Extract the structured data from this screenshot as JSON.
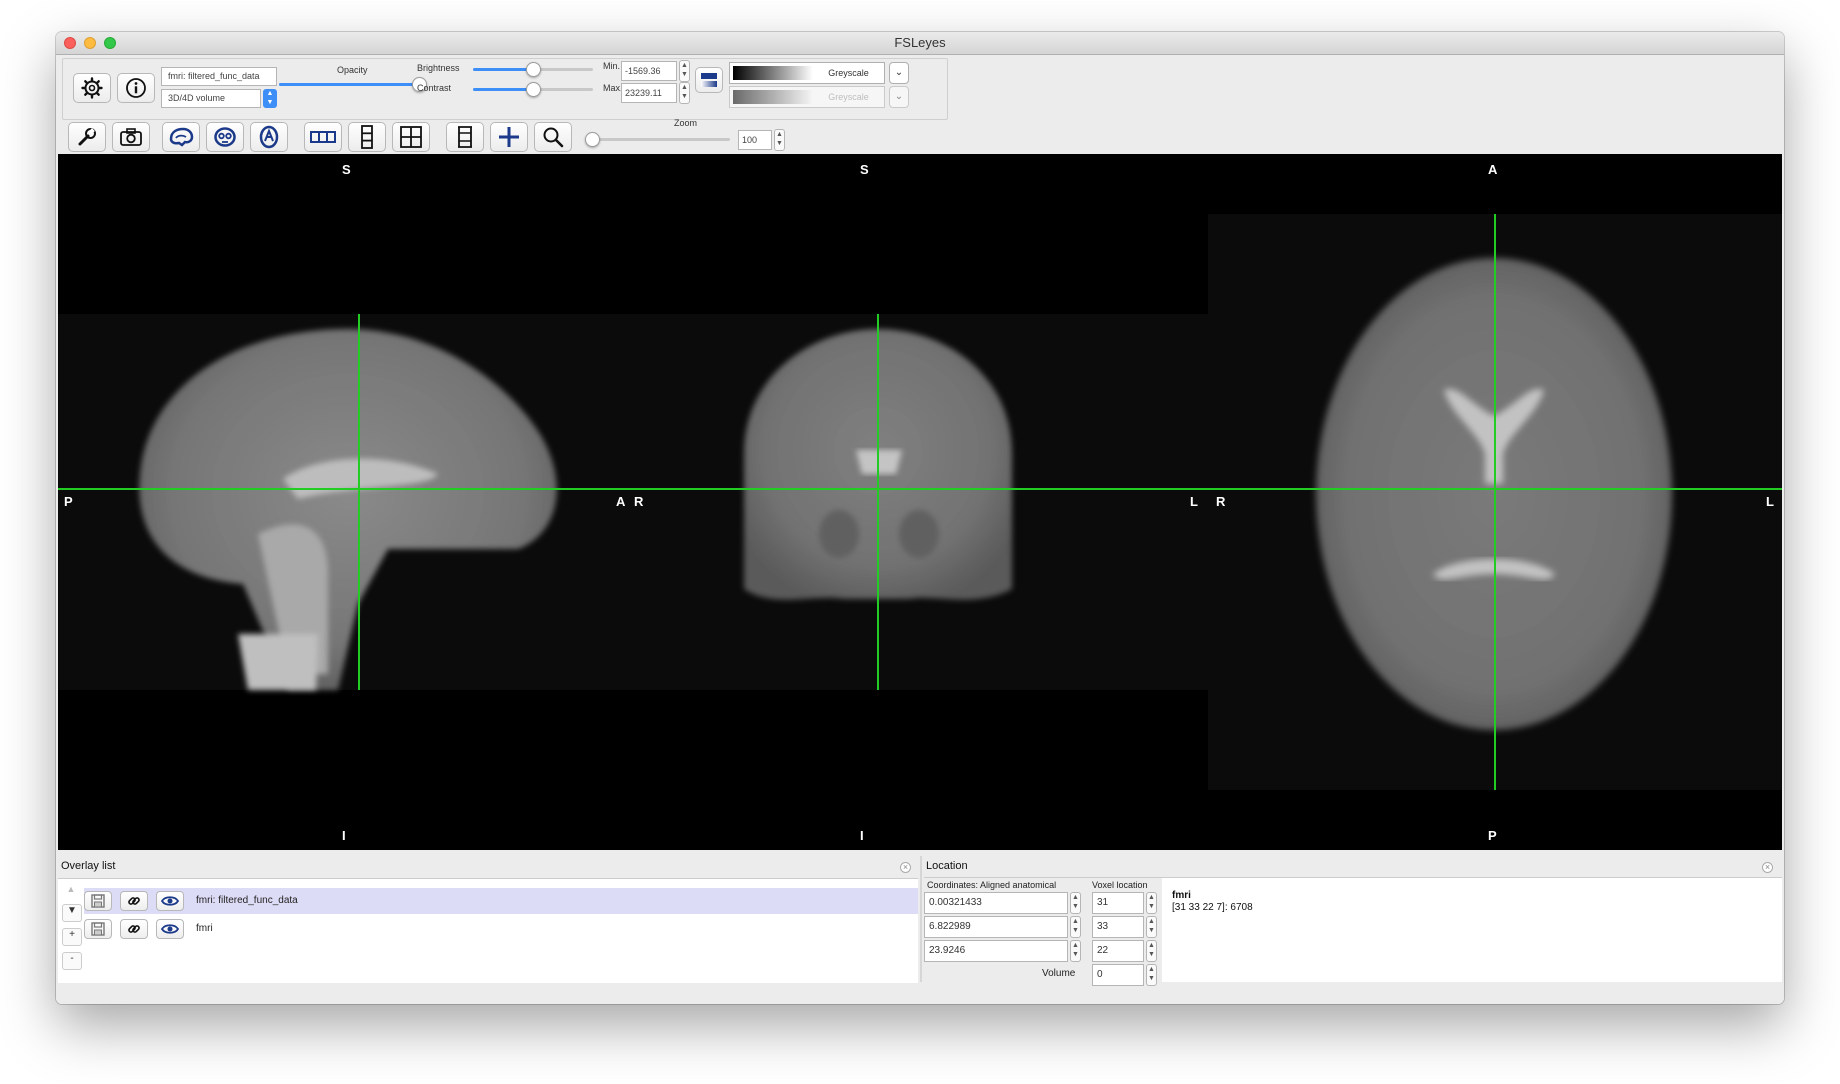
{
  "window": {
    "title": "FSLeyes"
  },
  "overlay_toolbar": {
    "overlay_name": "fmri: filtered_func_data",
    "overlay_type": "3D/4D volume",
    "opacity_label": "Opacity",
    "opacity": 1.0,
    "brightness_label": "Brightness",
    "brightness": 0.5,
    "contrast_label": "Contrast",
    "contrast": 0.5,
    "min_label": "Min.",
    "min_value": "-1569.36",
    "max_label": "Max.",
    "max_value": "23239.11",
    "cmap_label": "Greyscale",
    "neg_cmap_label": "Greyscale"
  },
  "ortho_toolbar": {
    "zoom_label": "Zoom",
    "zoom_value": "100",
    "zoom": 0.0
  },
  "views": {
    "sagittal": {
      "top": "S",
      "bottom": "I",
      "left": "P",
      "right": "A"
    },
    "coronal": {
      "top": "S",
      "bottom": "I",
      "left": "R",
      "right": "L"
    },
    "axial": {
      "top": "A",
      "bottom": "P",
      "left": "R",
      "right": "L"
    }
  },
  "overlay_list": {
    "title": "Overlay list",
    "items": [
      {
        "name": "fmri: filtered_func_data",
        "selected": true
      },
      {
        "name": "fmri",
        "selected": false
      }
    ],
    "up_glyph": "▲",
    "down_glyph": "▼",
    "add_glyph": "+",
    "remove_glyph": "-"
  },
  "location": {
    "title": "Location",
    "coords_label": "Coordinates: Aligned anatomical",
    "voxel_label": "Voxel location",
    "coords": [
      "0.00321433",
      "6.822989",
      "23.9246"
    ],
    "voxels": [
      "31",
      "33",
      "22"
    ],
    "volume_label": "Volume",
    "volume_value": "0",
    "info_name": "fmri",
    "info_value": "[31 33 22 7]: 6708"
  },
  "colors": {
    "accent": "#3d8ef7",
    "crosshair": "#22cc22",
    "icon_blue": "#1c3a8a",
    "selected_row": "#dcdcf6"
  },
  "icons": [
    "gear-icon",
    "info-icon",
    "wrench-icon",
    "camera-icon",
    "sagittal-view-icon",
    "coronal-view-icon",
    "axial-view-icon",
    "horizontal-layout-icon",
    "vertical-layout-icon",
    "grid-layout-icon",
    "movie-mode-icon",
    "crosshair-icon",
    "zoom-icon",
    "save-icon",
    "link-icon",
    "eye-icon"
  ]
}
